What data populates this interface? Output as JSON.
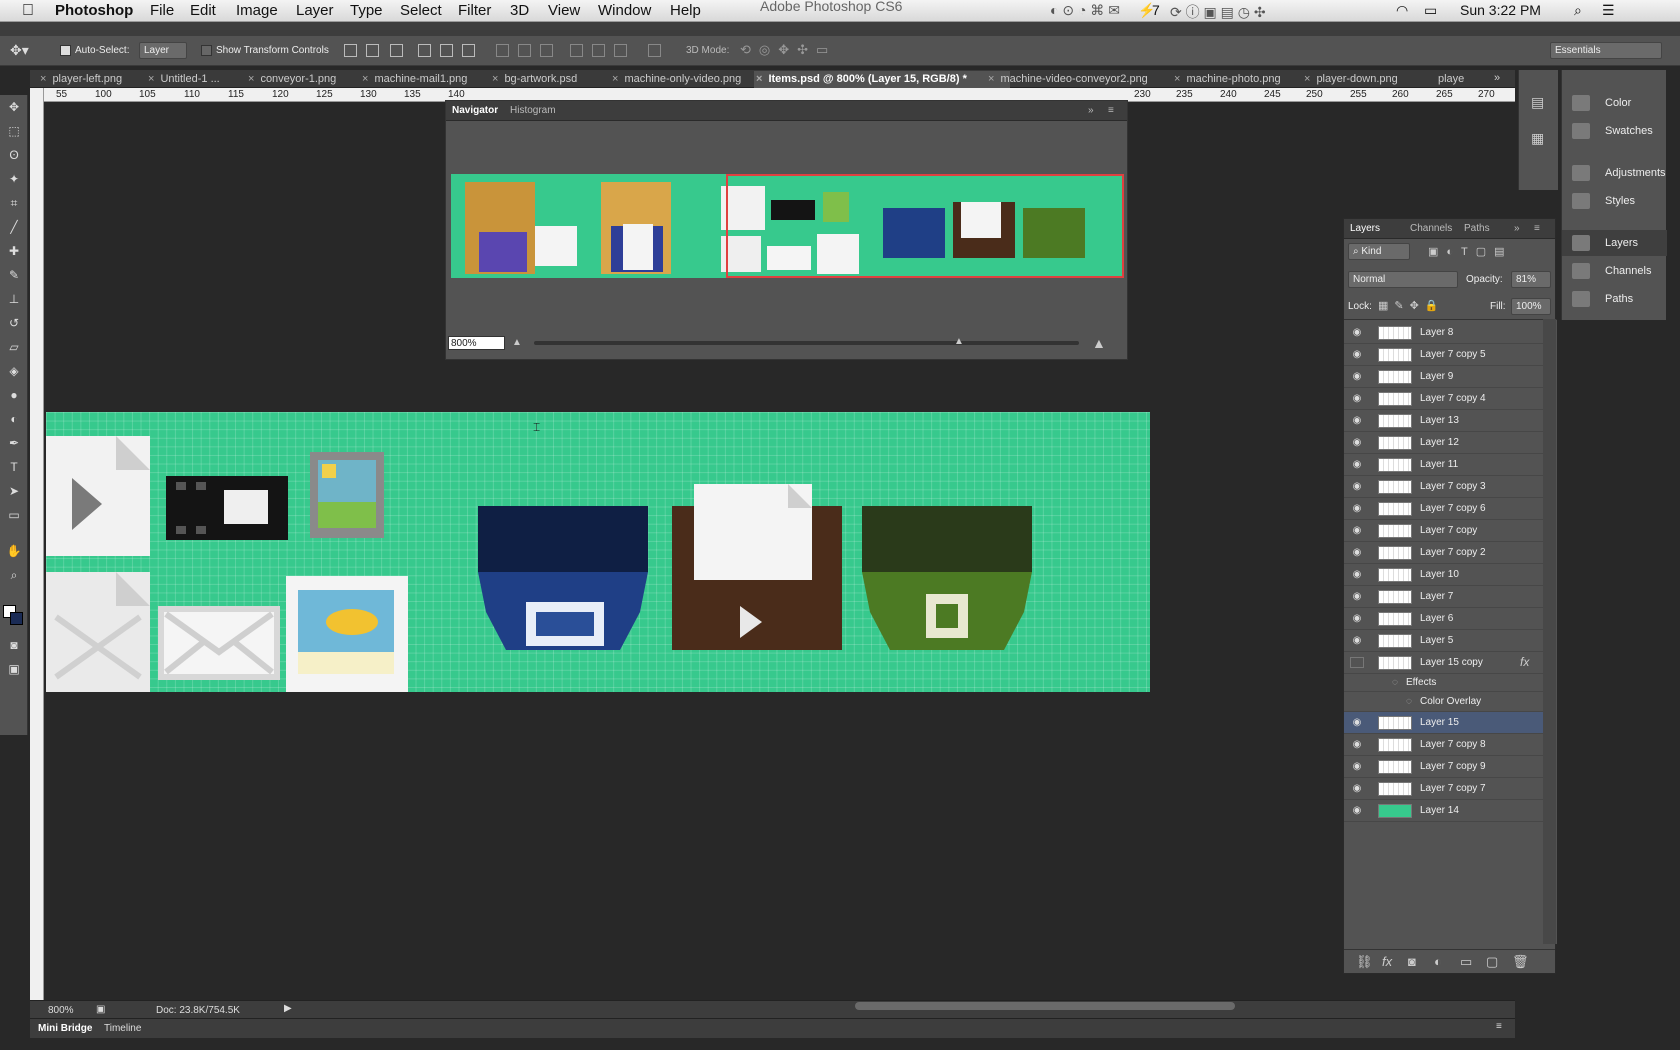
{
  "menubar": {
    "app_name": "Photoshop",
    "items": [
      "File",
      "Edit",
      "Image",
      "Layer",
      "Type",
      "Select",
      "Filter",
      "3D",
      "View",
      "Window",
      "Help"
    ],
    "window_title": "Adobe Photoshop CS6",
    "battery": "7",
    "clock": "Sun 3:22 PM"
  },
  "options_bar": {
    "auto_select_label": "Auto-Select:",
    "auto_select_value": "Layer",
    "show_transform_label": "Show Transform Controls",
    "mode_3d_label": "3D Mode:",
    "workspace": "Essentials"
  },
  "tabs": [
    {
      "label": "player-left.png",
      "active": false
    },
    {
      "label": "Untitled-1 ...",
      "active": false
    },
    {
      "label": "conveyor-1.png",
      "active": false
    },
    {
      "label": "machine-mail1.png",
      "active": false
    },
    {
      "label": "bg-artwork.psd",
      "active": false
    },
    {
      "label": "machine-only-video.png",
      "active": false
    },
    {
      "label": "Items.psd @ 800% (Layer 15, RGB/8) *",
      "active": true
    },
    {
      "label": "machine-video-conveyor2.png",
      "active": false
    },
    {
      "label": "machine-photo.png",
      "active": false
    },
    {
      "label": "player-down.png",
      "active": false
    },
    {
      "label": "playe",
      "active": false
    }
  ],
  "ruler_top": [
    "55",
    "100",
    "105",
    "110",
    "115",
    "120",
    "125",
    "130",
    "135",
    "140",
    "230",
    "235",
    "240",
    "245",
    "250",
    "255",
    "260",
    "265",
    "270"
  ],
  "navigator": {
    "tab_navigator": "Navigator",
    "tab_histogram": "Histogram",
    "zoom": "800%"
  },
  "status": {
    "zoom": "800%",
    "doc": "Doc: 23.8K/754.5K"
  },
  "bottom_tabs": [
    "Mini Bridge",
    "Timeline"
  ],
  "dock": {
    "items": [
      "Color",
      "Swatches",
      "Adjustments",
      "Styles",
      "Layers",
      "Channels",
      "Paths"
    ],
    "selected": "Layers"
  },
  "layers_panel": {
    "tabs": [
      "Layers",
      "Channels",
      "Paths"
    ],
    "filter_kind": "Kind",
    "blend_mode": "Normal",
    "opacity_label": "Opacity:",
    "opacity": "81%",
    "lock_label": "Lock:",
    "fill_label": "Fill:",
    "fill": "100%",
    "effects_label": "Effects",
    "color_overlay_label": "Color Overlay",
    "fx_symbol": "fx",
    "layers": [
      {
        "name": "Layer 8"
      },
      {
        "name": "Layer 7 copy 5"
      },
      {
        "name": "Layer 9"
      },
      {
        "name": "Layer 7 copy 4"
      },
      {
        "name": "Layer 13"
      },
      {
        "name": "Layer 12"
      },
      {
        "name": "Layer 11"
      },
      {
        "name": "Layer 7 copy 3"
      },
      {
        "name": "Layer 7 copy 6"
      },
      {
        "name": "Layer 7 copy"
      },
      {
        "name": "Layer 7 copy 2"
      },
      {
        "name": "Layer 10"
      },
      {
        "name": "Layer 7"
      },
      {
        "name": "Layer 6"
      },
      {
        "name": "Layer 5"
      },
      {
        "name": "Layer 15 copy"
      },
      {
        "name": "Layer 15"
      },
      {
        "name": "Layer 7 copy 8"
      },
      {
        "name": "Layer 7 copy 9"
      },
      {
        "name": "Layer 7 copy 7"
      },
      {
        "name": "Layer 14"
      }
    ]
  },
  "colors": {
    "canvas_bg": "#37c98d",
    "accent_selected": "#4a5a78",
    "nav_frame": "#e04040",
    "bin_blue": "#1f3f86",
    "bin_brown": "#4a2c1a",
    "bin_green": "#4c7a23"
  }
}
